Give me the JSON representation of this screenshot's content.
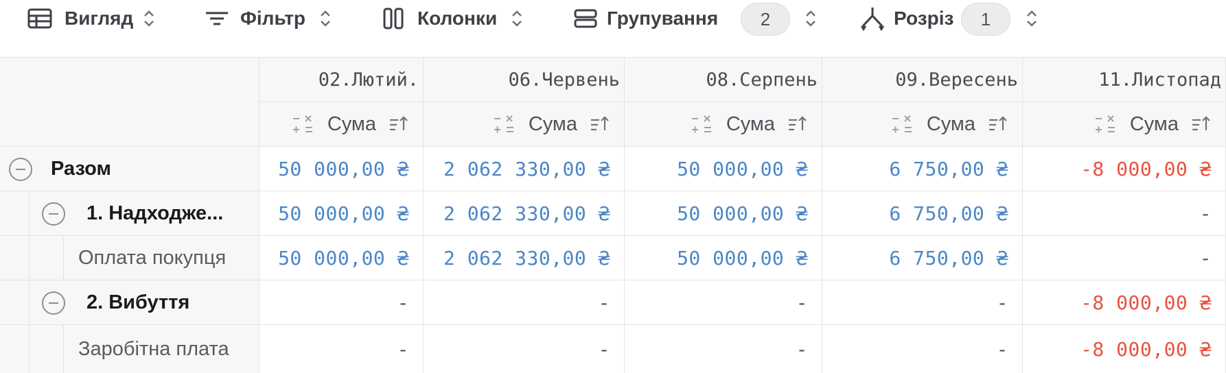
{
  "toolbar": {
    "view": "Вигляд",
    "filter": "Фільтр",
    "columns": "Колонки",
    "grouping": "Групування",
    "grouping_count": "2",
    "slice": "Розріз",
    "slice_count": "1"
  },
  "columns": [
    {
      "date": "02.Лютий.",
      "agg": "Сума"
    },
    {
      "date": "06.Червень",
      "agg": "Сума"
    },
    {
      "date": "08.Серпень",
      "agg": "Сума"
    },
    {
      "date": "09.Вересень",
      "agg": "Сума"
    },
    {
      "date": "11.Листопад",
      "agg": "Сума"
    }
  ],
  "rows": [
    {
      "label": "Разом",
      "values": [
        "50 000,00 ₴",
        "2 062 330,00 ₴",
        "50 000,00 ₴",
        "6 750,00 ₴",
        "-8 000,00 ₴"
      ]
    },
    {
      "label": "1. Надходже...",
      "values": [
        "50 000,00 ₴",
        "2 062 330,00 ₴",
        "50 000,00 ₴",
        "6 750,00 ₴",
        "-"
      ]
    },
    {
      "label": "Оплата покупця",
      "values": [
        "50 000,00 ₴",
        "2 062 330,00 ₴",
        "50 000,00 ₴",
        "6 750,00 ₴",
        "-"
      ]
    },
    {
      "label": "2. Вибуття",
      "values": [
        "-",
        "-",
        "-",
        "-",
        "-8 000,00 ₴"
      ]
    },
    {
      "label": "Заробітна плата",
      "values": [
        "-",
        "-",
        "-",
        "-",
        "-8 000,00 ₴"
      ]
    }
  ],
  "colors": {
    "positive": "#4a86c8",
    "negative": "#e8523f"
  }
}
